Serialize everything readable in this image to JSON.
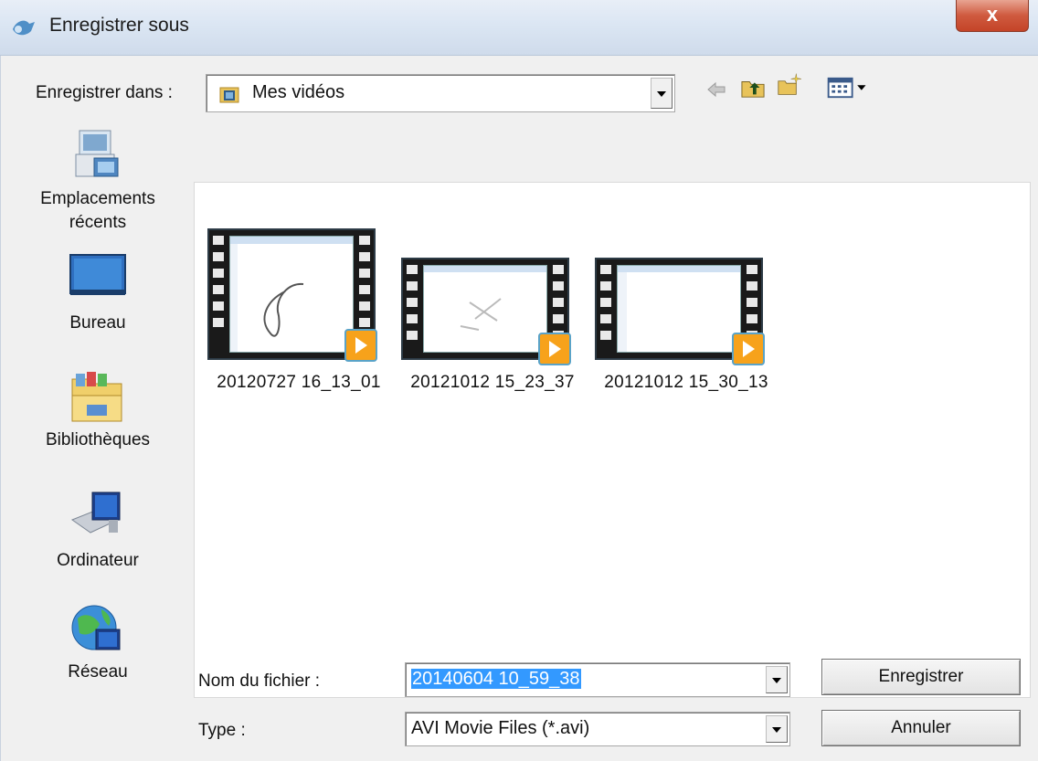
{
  "window": {
    "title": "Enregistrer sous",
    "close_label": "x"
  },
  "toolbar": {
    "save_in_label": "Enregistrer dans :",
    "location": "Mes vidéos",
    "icons": [
      "back-arrow-icon",
      "up-folder-icon",
      "new-folder-icon",
      "view-menu-icon"
    ]
  },
  "places": [
    {
      "label": "Emplacements récents",
      "icon": "recent-places-icon"
    },
    {
      "label": "Bureau",
      "icon": "desktop-icon"
    },
    {
      "label": "Bibliothèques",
      "icon": "libraries-icon"
    },
    {
      "label": "Ordinateur",
      "icon": "computer-icon"
    },
    {
      "label": "Réseau",
      "icon": "network-icon"
    }
  ],
  "files": [
    {
      "name": "20120727 16_13_01"
    },
    {
      "name": "20121012 15_23_37"
    },
    {
      "name": "20121012 15_30_13"
    }
  ],
  "filename": {
    "label": "Nom du fichier :",
    "value": "20140604 10_59_38"
  },
  "filetype": {
    "label": "Type :",
    "value": "AVI Movie Files (*.avi)"
  },
  "buttons": {
    "save": "Enregistrer",
    "cancel": "Annuler"
  },
  "colors": {
    "selection": "#3399ff",
    "close": "#c44428",
    "play": "#f7a21b"
  }
}
